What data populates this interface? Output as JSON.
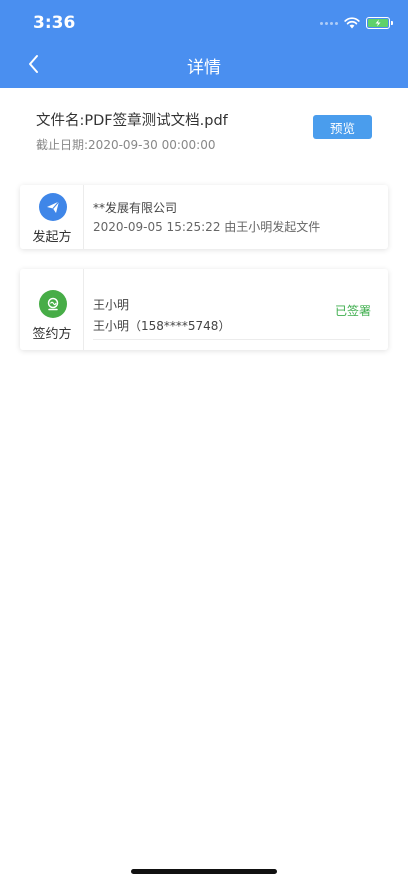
{
  "status_bar": {
    "time": "3:36"
  },
  "header": {
    "title": "详情"
  },
  "file": {
    "name": "文件名:PDF签章测试文档.pdf",
    "deadline": "截止日期:2020-09-30 00:00:00",
    "preview_label": "预览"
  },
  "initiator": {
    "role_label": "发起方",
    "company": "**发展有限公司",
    "detail": "2020-09-05 15:25:22 由王小明发起文件"
  },
  "signer": {
    "role_label": "签约方",
    "name": "王小明",
    "contact": "王小明（158****5748）",
    "status": "已签署"
  },
  "colors": {
    "header": "#4a8ff0",
    "accent_button": "#4a9ded",
    "initiator_icon": "#3f86e8",
    "signer_icon": "#47ad47",
    "signed_status": "#3fae4e"
  },
  "icons": {
    "back": "chevron-left-icon",
    "initiator": "paper-plane-icon",
    "signer": "signature-seal-icon"
  }
}
